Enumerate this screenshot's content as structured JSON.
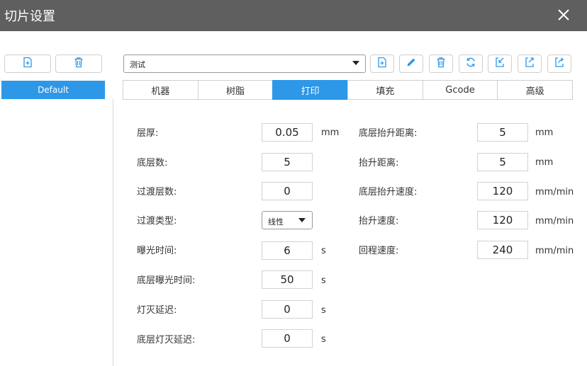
{
  "window": {
    "title": "切片设置",
    "close_icon": "close-icon"
  },
  "sidebar": {
    "buttons": [
      {
        "icon": "add-file-icon"
      },
      {
        "icon": "trash-icon"
      }
    ],
    "profiles": [
      "Default"
    ]
  },
  "toolbar": {
    "profile_select": {
      "value": "测试"
    },
    "buttons": [
      {
        "icon": "add-file-icon"
      },
      {
        "icon": "pencil-icon"
      },
      {
        "icon": "trash-icon"
      },
      {
        "icon": "refresh-icon"
      },
      {
        "icon": "import-icon"
      },
      {
        "icon": "export-icon"
      },
      {
        "icon": "share-icon"
      }
    ]
  },
  "tabs": [
    {
      "label": "机器",
      "active": false
    },
    {
      "label": "树脂",
      "active": false
    },
    {
      "label": "打印",
      "active": true
    },
    {
      "label": "填充",
      "active": false
    },
    {
      "label": "Gcode",
      "active": false
    },
    {
      "label": "高级",
      "active": false
    }
  ],
  "left_fields": [
    {
      "label": "层厚:",
      "value": "0.05",
      "unit": "mm"
    },
    {
      "label": "底层数:",
      "value": "5",
      "unit": ""
    },
    {
      "label": "过渡层数:",
      "value": "0",
      "unit": ""
    },
    {
      "label": "过渡类型:",
      "value": "线性",
      "unit": "",
      "type": "select"
    },
    {
      "label": "曝光时间:",
      "value": "6",
      "unit": "s"
    },
    {
      "label": "底层曝光时间:",
      "value": "50",
      "unit": "s"
    },
    {
      "label": "灯灭延迟:",
      "value": "0",
      "unit": "s"
    },
    {
      "label": "底层灯灭延迟:",
      "value": "0",
      "unit": "s"
    }
  ],
  "right_fields": [
    {
      "label": "底层抬升距离:",
      "value": "5",
      "unit": "mm"
    },
    {
      "label": "抬升距离:",
      "value": "5",
      "unit": "mm"
    },
    {
      "label": "底层抬升速度:",
      "value": "120",
      "unit": "mm/min"
    },
    {
      "label": "抬升速度:",
      "value": "120",
      "unit": "mm/min"
    },
    {
      "label": "回程速度:",
      "value": "240",
      "unit": "mm/min"
    }
  ],
  "colors": {
    "accent": "#2d97e8",
    "titlebar": "#5f5f5f"
  }
}
